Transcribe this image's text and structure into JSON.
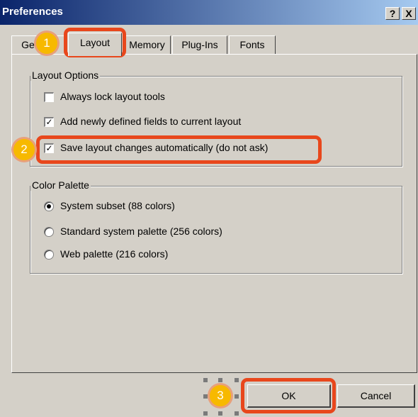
{
  "window": {
    "title": "Preferences",
    "help_label": "?",
    "close_label": "X"
  },
  "tabs": [
    {
      "label": "General",
      "active": false
    },
    {
      "label": "Layout",
      "active": true
    },
    {
      "label": "Memory",
      "active": false
    },
    {
      "label": "Plug-Ins",
      "active": false
    },
    {
      "label": "Fonts",
      "active": false
    }
  ],
  "layout_options": {
    "legend": "Layout Options",
    "items": [
      {
        "label": "Always lock layout tools",
        "checked": false
      },
      {
        "label": "Add newly defined fields to current layout",
        "checked": true
      },
      {
        "label": "Save layout changes automatically (do not ask)",
        "checked": true
      }
    ]
  },
  "color_palette": {
    "legend": "Color Palette",
    "options": [
      {
        "label": "System subset (88 colors)",
        "selected": true
      },
      {
        "label": "Standard system palette (256 colors)",
        "selected": false
      },
      {
        "label": "Web palette (216 colors)",
        "selected": false
      }
    ]
  },
  "buttons": {
    "ok": "OK",
    "cancel": "Cancel"
  },
  "annotations": {
    "markers": [
      "1",
      "2",
      "3"
    ],
    "highlight_color": "#e8471c",
    "marker_color": "#f7b900"
  },
  "check_glyph": "✓"
}
